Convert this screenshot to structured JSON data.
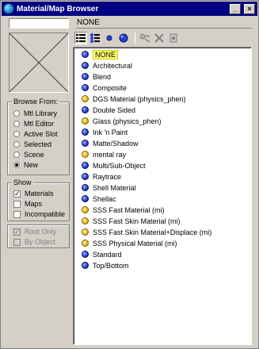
{
  "window": {
    "title": "Material/Map Browser",
    "buttons": {
      "minimize": "_",
      "maximize": "□",
      "close": "×"
    }
  },
  "selected_name": "NONE",
  "toolbar": {
    "icons": [
      "view-list-icon",
      "view-list-icons-icon",
      "small-icons-icon",
      "large-icons-icon",
      "update-scene-materials-icon",
      "delete-icon",
      "clear-material-library-icon"
    ]
  },
  "browse_from": {
    "title": "Browse From:",
    "options": [
      {
        "label": "Mtl Library",
        "checked": false
      },
      {
        "label": "Mtl Editor",
        "checked": false
      },
      {
        "label": "Active Slot",
        "checked": false
      },
      {
        "label": "Selected",
        "checked": false
      },
      {
        "label": "Scene",
        "checked": false
      },
      {
        "label": "New",
        "checked": true
      }
    ]
  },
  "show": {
    "title": "Show",
    "options": [
      {
        "label": "Materials",
        "checked": true,
        "disabled": false
      },
      {
        "label": "Maps",
        "checked": false,
        "disabled": false
      },
      {
        "label": "Incompatible",
        "checked": false,
        "disabled": false
      }
    ]
  },
  "show_extra": {
    "options": [
      {
        "label": "Root Only",
        "checked": true,
        "disabled": true
      },
      {
        "label": "By Object",
        "checked": false,
        "disabled": true
      }
    ]
  },
  "materials": [
    {
      "label": "NONE",
      "color": "blue",
      "selected": true
    },
    {
      "label": "Architectural",
      "color": "blue"
    },
    {
      "label": "Blend",
      "color": "blue"
    },
    {
      "label": "Composite",
      "color": "blue"
    },
    {
      "label": "DGS Material (physics_phen)",
      "color": "yellow"
    },
    {
      "label": "Double Sided",
      "color": "blue"
    },
    {
      "label": "Glass (physics_phen)",
      "color": "yellow"
    },
    {
      "label": "Ink 'n Paint",
      "color": "blue"
    },
    {
      "label": "Matte/Shadow",
      "color": "blue"
    },
    {
      "label": "mental ray",
      "color": "yellow"
    },
    {
      "label": "Multi/Sub-Object",
      "color": "blue"
    },
    {
      "label": "Raytrace",
      "color": "blue"
    },
    {
      "label": "Shell Material",
      "color": "blue"
    },
    {
      "label": "Shellac",
      "color": "blue"
    },
    {
      "label": "SSS Fast Material (mi)",
      "color": "yellow"
    },
    {
      "label": "SSS Fast Skin Material (mi)",
      "color": "yellow"
    },
    {
      "label": "SSS Fast Skin Material+Displace (mi)",
      "color": "yellow"
    },
    {
      "label": "SSS Physical Material (mi)",
      "color": "yellow"
    },
    {
      "label": "Standard",
      "color": "blue"
    },
    {
      "label": "Top/Bottom",
      "color": "blue"
    }
  ]
}
